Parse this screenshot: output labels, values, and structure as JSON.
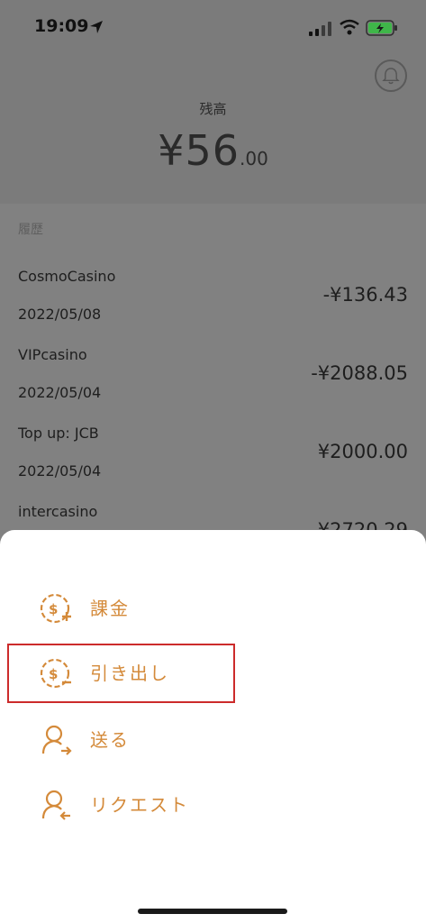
{
  "status_bar": {
    "time": "19:09"
  },
  "header": {
    "balance_label": "残高",
    "balance_main": "¥56",
    "balance_cents": ".00"
  },
  "history": {
    "label": "履歴",
    "items": [
      {
        "name": "CosmoCasino",
        "date": "2022/05/08",
        "amount": "-¥136.43"
      },
      {
        "name": "VIPcasino",
        "date": "2022/05/04",
        "amount": "-¥2088.05"
      },
      {
        "name": "Top up: JCB",
        "date": "2022/05/04",
        "amount": "¥2000.00"
      },
      {
        "name": "intercasino",
        "date": "",
        "amount": "-¥2720.29"
      }
    ]
  },
  "sheet": {
    "items": [
      {
        "label": "課金",
        "icon": "coin-plus-icon"
      },
      {
        "label": "引き出し",
        "icon": "coin-minus-icon"
      },
      {
        "label": "送る",
        "icon": "person-send-icon"
      },
      {
        "label": "リクエスト",
        "icon": "person-request-icon"
      }
    ]
  },
  "colors": {
    "accent": "#d48a3a",
    "highlight_border": "#cc2b2b",
    "overlay": "#7e7e7e"
  }
}
